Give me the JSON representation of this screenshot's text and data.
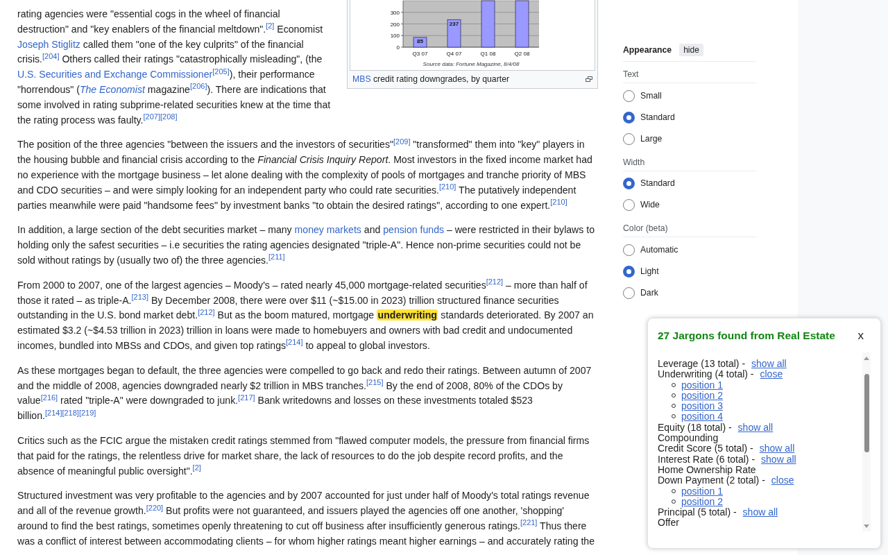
{
  "article": {
    "figure": {
      "chart_data": {
        "type": "bar",
        "categories": [
          "Q3 07",
          "Q4 07",
          "Q1 08",
          "Q2 08"
        ],
        "values": [
          85,
          237,
          400,
          400
        ],
        "ylim": [
          0,
          400
        ],
        "yticks": [
          0,
          100,
          200,
          300
        ],
        "grid": true,
        "value_labels": [
          "85",
          "237",
          null,
          null
        ],
        "annotations": [
          "Source data: Fortune Magazine, 8/4/08"
        ]
      },
      "caption": [
        {
          "kind": "link",
          "text": "MBS"
        },
        {
          "kind": "text",
          "text": " credit rating downgrades, by quarter"
        }
      ]
    },
    "paragraphs": [
      {
        "parts": [
          {
            "kind": "text",
            "text": "rating agencies were \"essential cogs in the wheel of financial destruction\" and \"key enablers of the financial meltdown\"."
          },
          {
            "kind": "ref",
            "text": "[2]"
          },
          {
            "kind": "text",
            "text": " Economist "
          },
          {
            "kind": "link",
            "text": "Joseph Stiglitz"
          },
          {
            "kind": "text",
            "text": " called them \"one of the key culprits\" of the financial crisis."
          },
          {
            "kind": "ref",
            "text": "[204]"
          },
          {
            "kind": "text",
            "text": " Others called their ratings \"catastrophically misleading\", (the "
          },
          {
            "kind": "link",
            "text": "U.S. Securities and Exchange Commissioner"
          },
          {
            "kind": "ref",
            "text": "[205]"
          },
          {
            "kind": "text",
            "text": "), their performance \"horrendous\" ("
          },
          {
            "kind": "italic_link",
            "text": "The Economist"
          },
          {
            "kind": "text",
            "text": " magazine"
          },
          {
            "kind": "ref",
            "text": "[206]"
          },
          {
            "kind": "text",
            "text": "). There are indications that some involved in rating subprime-related securities knew at the time that the rating process was faulty."
          },
          {
            "kind": "ref",
            "text": "[207]"
          },
          {
            "kind": "ref",
            "text": "[208]"
          }
        ]
      },
      {
        "parts": [
          {
            "kind": "text",
            "text": "The position of the three agencies \"between the issuers and the investors of securities\""
          },
          {
            "kind": "ref",
            "text": "[209]"
          },
          {
            "kind": "text",
            "text": " \"transformed\" them into \"key\" players in the housing bubble and financial crisis according to the "
          },
          {
            "kind": "italic",
            "text": "Financial Crisis Inquiry Report"
          },
          {
            "kind": "text",
            "text": ". Most investors in the fixed income market had no experience with the mortgage business – let alone dealing with the complexity of pools of mortgages and tranche priority of MBS and CDO securities – and were simply looking for an independent party who could rate securities."
          },
          {
            "kind": "ref",
            "text": "[210]"
          },
          {
            "kind": "text",
            "text": " The putatively independent parties meanwhile were paid \"handsome fees\" by investment banks \"to obtain the desired ratings\", according to one expert."
          },
          {
            "kind": "ref",
            "text": "[210]"
          }
        ]
      },
      {
        "parts": [
          {
            "kind": "text",
            "text": "In addition, a large section of the debt securities market – many "
          },
          {
            "kind": "link",
            "text": "money markets"
          },
          {
            "kind": "text",
            "text": " and "
          },
          {
            "kind": "link",
            "text": "pension funds"
          },
          {
            "kind": "text",
            "text": " – were restricted in their bylaws to holding only the safest securities – i.e securities the rating agencies designated \"triple-A\". Hence non-prime securities could not be sold without ratings by (usually two of) the three agencies."
          },
          {
            "kind": "ref",
            "text": "[211]"
          }
        ]
      },
      {
        "parts": [
          {
            "kind": "text",
            "text": "From 2000 to 2007, one of the largest agencies – Moody's – rated nearly 45,000 mortgage-related securities"
          },
          {
            "kind": "ref",
            "text": "[212]"
          },
          {
            "kind": "text",
            "text": " – more than half of those it rated – as triple-A."
          },
          {
            "kind": "ref",
            "text": "[213]"
          },
          {
            "kind": "text",
            "text": " By December 2008, there were over $11 (~$15.00 in 2023) trillion structured finance securities outstanding in the U.S. bond market debt."
          },
          {
            "kind": "ref",
            "text": "[212]"
          },
          {
            "kind": "text",
            "text": " But as the boom matured, mortgage "
          },
          {
            "kind": "highlight",
            "text": "underwriting"
          },
          {
            "kind": "text",
            "text": " standards deteriorated. By 2007 an estimated $3.2 (~$4.53 trillion in 2023) trillion in loans were made to homebuyers and owners with bad credit and undocumented incomes, bundled into MBSs and CDOs, and given top ratings"
          },
          {
            "kind": "ref",
            "text": "[214]"
          },
          {
            "kind": "text",
            "text": " to appeal to global investors."
          }
        ]
      },
      {
        "parts": [
          {
            "kind": "text",
            "text": "As these mortgages began to default, the three agencies were compelled to go back and redo their ratings. Between autumn of 2007 and the middle of 2008, agencies downgraded nearly $2 trillion in MBS tranches."
          },
          {
            "kind": "ref",
            "text": "[215]"
          },
          {
            "kind": "text",
            "text": " By the end of 2008, 80% of the CDOs by value"
          },
          {
            "kind": "ref",
            "text": "[216]"
          },
          {
            "kind": "text",
            "text": " rated \"triple-A\" were downgraded to junk."
          },
          {
            "kind": "ref",
            "text": "[217]"
          },
          {
            "kind": "text",
            "text": " Bank writedowns and losses on these investments totaled $523 billion."
          },
          {
            "kind": "ref",
            "text": "[214]"
          },
          {
            "kind": "ref",
            "text": "[218]"
          },
          {
            "kind": "ref",
            "text": "[219]"
          }
        ]
      },
      {
        "parts": [
          {
            "kind": "text",
            "text": "Critics such as the FCIC argue the mistaken credit ratings stemmed from \"flawed computer models, the pressure from financial firms that paid for the ratings, the relentless drive for market share, the lack of resources to do the job despite record profits, and the absence of meaningful public oversight\"."
          },
          {
            "kind": "ref",
            "text": "[2]"
          }
        ]
      },
      {
        "parts": [
          {
            "kind": "text",
            "text": "Structured investment was very profitable to the agencies and by 2007 accounted for just under half of Moody's total ratings revenue and all of the revenue growth."
          },
          {
            "kind": "ref",
            "text": "[220]"
          },
          {
            "kind": "text",
            "text": " But profits were not guaranteed, and issuers played the agencies off one another, 'shopping' around to find the best ratings, sometimes openly threatening to cut off business after insufficiently generous ratings."
          },
          {
            "kind": "ref",
            "text": "[221]"
          },
          {
            "kind": "text",
            "text": " Thus there was a conflict of interest between accommodating clients – for whom higher ratings meant higher earnings – and accurately rating the"
          }
        ]
      }
    ]
  },
  "appearance": {
    "title": "Appearance",
    "hide_label": "hide",
    "sections": [
      {
        "title": "Text",
        "options": [
          {
            "label": "Small",
            "selected": false
          },
          {
            "label": "Standard",
            "selected": true
          },
          {
            "label": "Large",
            "selected": false
          }
        ]
      },
      {
        "title": "Width",
        "options": [
          {
            "label": "Standard",
            "selected": true
          },
          {
            "label": "Wide",
            "selected": false
          }
        ]
      },
      {
        "title": "Color (beta)",
        "options": [
          {
            "label": "Automatic",
            "selected": false
          },
          {
            "label": "Light",
            "selected": true
          },
          {
            "label": "Dark",
            "selected": false
          }
        ]
      }
    ]
  },
  "jargon_popup": {
    "title": "27 Jargons found from Real Estate",
    "close_label": "x",
    "items": [
      {
        "term": "Leverage (13 total) -",
        "link": "show all"
      },
      {
        "term": "Underwriting (4 total) -",
        "link": "close",
        "children": [
          {
            "label": "position 1"
          },
          {
            "label": "position 2"
          },
          {
            "label": "position 3"
          },
          {
            "label": "position 4"
          }
        ]
      },
      {
        "term": "Equity (18 total) -",
        "link": "show all"
      },
      {
        "term": "Compounding"
      },
      {
        "term": "Credit Score (5 total) -",
        "link": "show all"
      },
      {
        "term": "Interest Rate (6 total) -",
        "link": "show all"
      },
      {
        "term": "Home Ownership Rate"
      },
      {
        "term": "Down Payment (2 total) -",
        "link": "close",
        "children": [
          {
            "label": "position 1"
          },
          {
            "label": "position 2"
          }
        ]
      },
      {
        "term": "Principal (5 total) -",
        "link": "show all"
      },
      {
        "term": "Offer"
      }
    ]
  }
}
